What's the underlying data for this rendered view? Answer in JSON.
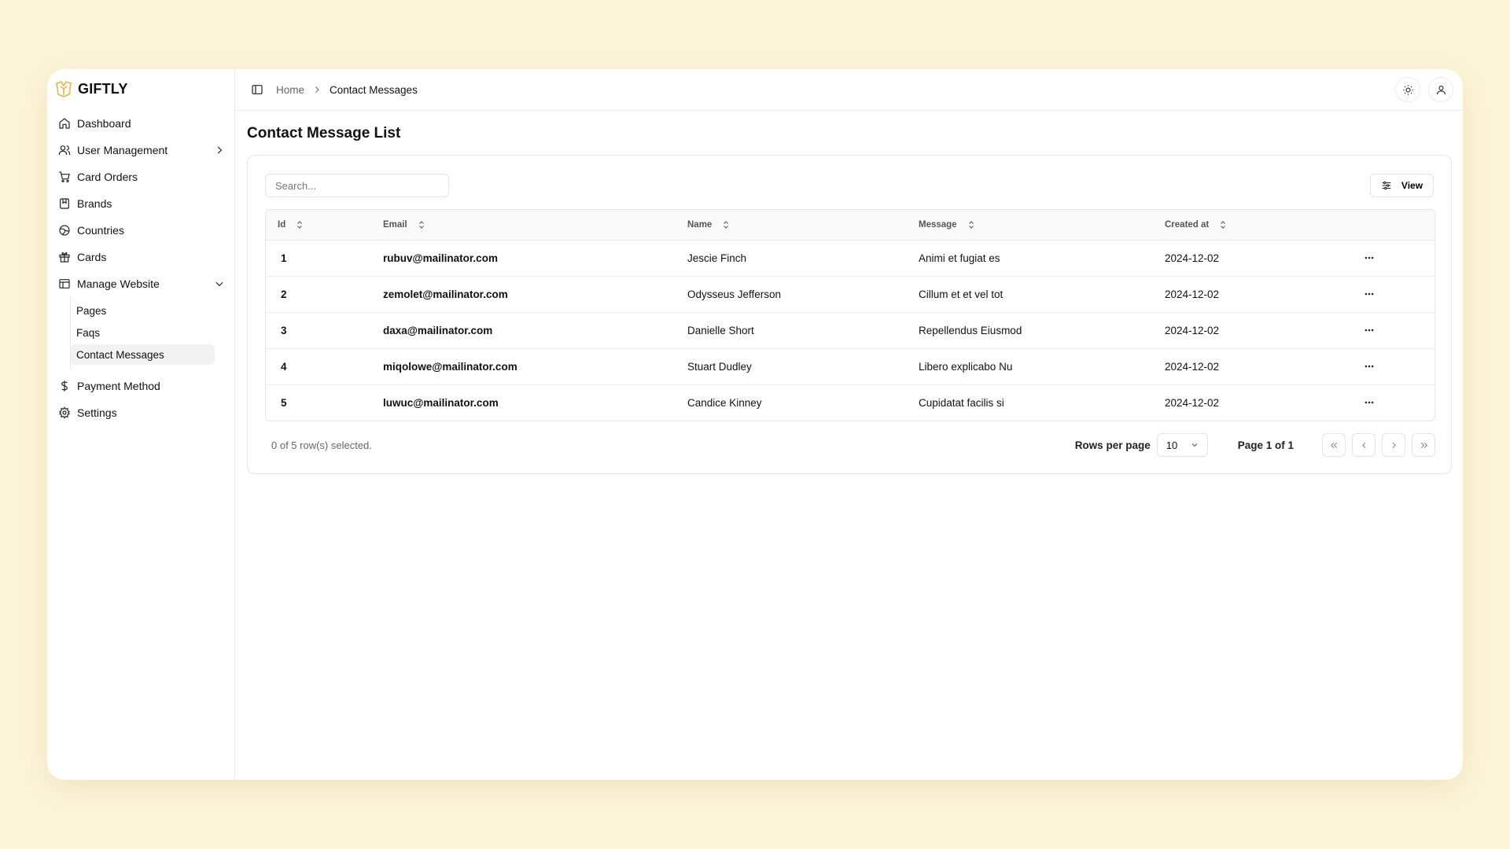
{
  "app": {
    "name": "GIFTLY"
  },
  "sidebar": {
    "items": [
      {
        "label": "Dashboard",
        "icon": "home-icon"
      },
      {
        "label": "User Management",
        "icon": "users-icon",
        "chevron": "right"
      },
      {
        "label": "Card Orders",
        "icon": "cart-icon"
      },
      {
        "label": "Brands",
        "icon": "bookmark-icon"
      },
      {
        "label": "Countries",
        "icon": "globe-icon"
      },
      {
        "label": "Cards",
        "icon": "gift-icon"
      },
      {
        "label": "Manage Website",
        "icon": "layout-icon",
        "chevron": "down"
      },
      {
        "label": "Payment Method",
        "icon": "dollar-icon"
      },
      {
        "label": "Settings",
        "icon": "gear-icon"
      }
    ],
    "sub_items": [
      {
        "label": "Pages"
      },
      {
        "label": "Faqs"
      },
      {
        "label": "Contact Messages",
        "active": true
      }
    ]
  },
  "breadcrumb": {
    "home": "Home",
    "current": "Contact Messages"
  },
  "page": {
    "title": "Contact Message List"
  },
  "toolbar": {
    "search_placeholder": "Search...",
    "view_label": "View"
  },
  "table": {
    "columns": [
      "Id",
      "Email",
      "Name",
      "Message",
      "Created at"
    ],
    "rows": [
      {
        "id": "1",
        "email": "rubuv@mailinator.com",
        "name": "Jescie Finch",
        "message": "Animi et fugiat es",
        "created": "2024-12-02"
      },
      {
        "id": "2",
        "email": "zemolet@mailinator.com",
        "name": "Odysseus Jefferson",
        "message": "Cillum et et vel tot",
        "created": "2024-12-02"
      },
      {
        "id": "3",
        "email": "daxa@mailinator.com",
        "name": "Danielle Short",
        "message": "Repellendus Eiusmod",
        "created": "2024-12-02"
      },
      {
        "id": "4",
        "email": "miqolowe@mailinator.com",
        "name": "Stuart Dudley",
        "message": "Libero explicabo Nu",
        "created": "2024-12-02"
      },
      {
        "id": "5",
        "email": "luwuc@mailinator.com",
        "name": "Candice Kinney",
        "message": "Cupidatat facilis si",
        "created": "2024-12-02"
      }
    ]
  },
  "footer": {
    "selected": "0 of 5 row(s) selected.",
    "rows_per_page_label": "Rows per page",
    "rows_per_page_value": "10",
    "page_info": "Page 1 of 1"
  },
  "colors": {
    "background": "#fdf5d8",
    "brand": "#e9b44c"
  }
}
